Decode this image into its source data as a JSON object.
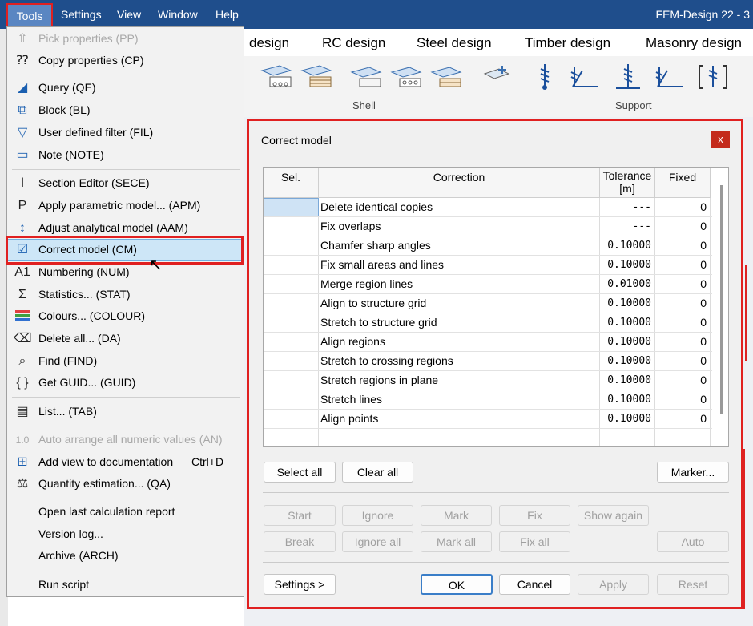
{
  "menubar": {
    "items": [
      "Tools",
      "Settings",
      "View",
      "Window",
      "Help"
    ],
    "app_title": "FEM-Design 22 - 3"
  },
  "ribbon": {
    "tabs": [
      "design",
      "RC design",
      "Steel design",
      "Timber design",
      "Masonry design"
    ],
    "groups": [
      "Shell",
      "Support"
    ]
  },
  "tools_menu": {
    "items": [
      {
        "label": "Pick properties (PP)",
        "icon": "pick-icon",
        "disabled": true
      },
      {
        "label": "Copy properties (CP)",
        "icon": "copy-properties-icon"
      },
      {
        "label": "Query (QE)",
        "icon": "query-icon"
      },
      {
        "label": "Block (BL)",
        "icon": "block-icon"
      },
      {
        "label": "User defined filter (FIL)",
        "icon": "filter-icon"
      },
      {
        "label": "Note (NOTE)",
        "icon": "note-icon"
      },
      {
        "label": "Section Editor (SECE)",
        "icon": "section-icon"
      },
      {
        "label": "Apply parametric model... (APM)",
        "icon": "parametric-icon"
      },
      {
        "label": "Adjust analytical model (AAM)",
        "icon": "adjust-icon"
      },
      {
        "label": "Correct model (CM)",
        "icon": "correct-model-icon"
      },
      {
        "label": "Numbering (NUM)",
        "icon": "numbering-icon"
      },
      {
        "label": "Statistics... (STAT)",
        "icon": "sigma-icon"
      },
      {
        "label": "Colours... (COLOUR)",
        "icon": "colours-icon"
      },
      {
        "label": "Delete all... (DA)",
        "icon": "eraser-icon"
      },
      {
        "label": "Find (FIND)",
        "icon": "find-icon"
      },
      {
        "label": "Get GUID... (GUID)",
        "icon": "braces-icon"
      },
      {
        "label": "List... (TAB)",
        "icon": "list-icon"
      },
      {
        "label": "Auto arrange all numeric values (AN)",
        "icon": "numeric-icon",
        "disabled": true
      },
      {
        "label": "Add view to documentation",
        "shortcut": "Ctrl+D",
        "icon": "add-view-icon"
      },
      {
        "label": "Quantity estimation... (QA)",
        "icon": "quantity-icon"
      },
      {
        "label": "Open last calculation report"
      },
      {
        "label": "Version log..."
      },
      {
        "label": "Archive (ARCH)"
      },
      {
        "label": "Run script"
      }
    ]
  },
  "dialog": {
    "title": "Correct model",
    "close": "x",
    "columns": [
      "Sel.",
      "Correction",
      "Tolerance\n[m]",
      "Fixed"
    ],
    "rows": [
      {
        "correction": "Delete identical copies",
        "tolerance": "---",
        "fixed": "0"
      },
      {
        "correction": "Fix overlaps",
        "tolerance": "---",
        "fixed": "0"
      },
      {
        "correction": "Chamfer sharp angles",
        "tolerance": "0.10000",
        "fixed": "0"
      },
      {
        "correction": "Fix small areas and lines",
        "tolerance": "0.10000",
        "fixed": "0"
      },
      {
        "correction": "Merge region lines",
        "tolerance": "0.01000",
        "fixed": "0"
      },
      {
        "correction": "Align to structure grid",
        "tolerance": "0.10000",
        "fixed": "0"
      },
      {
        "correction": "Stretch to structure grid",
        "tolerance": "0.10000",
        "fixed": "0"
      },
      {
        "correction": "Align regions",
        "tolerance": "0.10000",
        "fixed": "0"
      },
      {
        "correction": "Stretch to crossing regions",
        "tolerance": "0.10000",
        "fixed": "0"
      },
      {
        "correction": "Stretch regions in plane",
        "tolerance": "0.10000",
        "fixed": "0"
      },
      {
        "correction": "Stretch lines",
        "tolerance": "0.10000",
        "fixed": "0"
      },
      {
        "correction": "Align points",
        "tolerance": "0.10000",
        "fixed": "0"
      }
    ],
    "buttons": {
      "select_all": "Select all",
      "clear_all": "Clear all",
      "marker": "Marker...",
      "start": "Start",
      "ignore": "Ignore",
      "mark": "Mark",
      "fix": "Fix",
      "show_again": "Show again",
      "break": "Break",
      "ignore_all": "Ignore all",
      "mark_all": "Mark all",
      "fix_all": "Fix all",
      "auto": "Auto",
      "settings": "Settings >",
      "ok": "OK",
      "cancel": "Cancel",
      "apply": "Apply",
      "reset": "Reset"
    }
  }
}
